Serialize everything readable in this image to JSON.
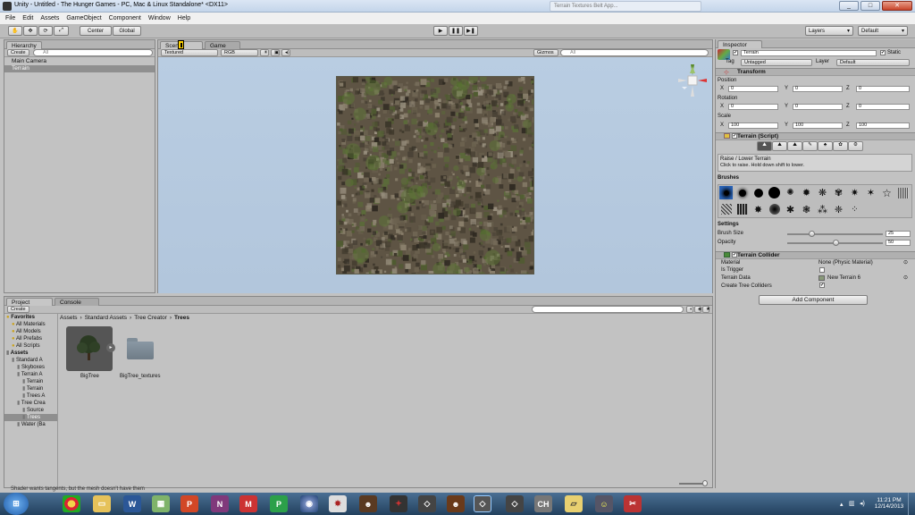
{
  "window": {
    "title": "Unity - Untitled - The Hunger Games - PC, Mac & Linux Standalone* <DX11>",
    "bg_tab_title": "Terrain Textures Belt App...",
    "controls": [
      "_",
      "□",
      "✕"
    ]
  },
  "menu": [
    "File",
    "Edit",
    "Assets",
    "GameObject",
    "Component",
    "Window",
    "Help"
  ],
  "toolbar": {
    "center_label": "Center",
    "global_label": "Global",
    "layers_label": "Layers",
    "layout_label": "Default"
  },
  "hierarchy": {
    "tab": "Hierarchy",
    "create": "Create",
    "search_placeholder": "All",
    "items": [
      "Main Camera",
      "Terrain"
    ]
  },
  "scene": {
    "tab_scene": "Scene",
    "tab_game": "Game",
    "render_mode": "Textured",
    "color_mode": "RGB",
    "gizmos": "Gizmos",
    "search_placeholder": "All"
  },
  "inspector": {
    "tab": "Inspector",
    "object_name": "Terrain",
    "static_label": "Static",
    "tag_label": "Tag",
    "tag_value": "Untagged",
    "layer_label": "Layer",
    "layer_value": "Default",
    "transform": {
      "title": "Transform",
      "position_label": "Position",
      "rotation_label": "Rotation",
      "scale_label": "Scale",
      "position": [
        "0",
        "0",
        "0"
      ],
      "rotation": [
        "0",
        "0",
        "0"
      ],
      "scale": [
        "100",
        "100",
        "100"
      ]
    },
    "terrain_script": {
      "title": "Terrain (Script)",
      "tool_title": "Raise / Lower Terrain",
      "tool_desc": "Click to raise. Hold down shift to lower.",
      "brushes_label": "Brushes",
      "settings_label": "Settings",
      "brush_size_label": "Brush Size",
      "brush_size": "25",
      "brush_size_level": 0.25,
      "opacity_label": "Opacity",
      "opacity": "50",
      "opacity_level": 0.5
    },
    "collider": {
      "title": "Terrain Collider",
      "material_label": "Material",
      "material_value": "None (Physic Material)",
      "trigger_label": "Is Trigger",
      "data_label": "Terrain Data",
      "data_value": "New Terrain 6",
      "trees_label": "Create Tree Colliders"
    },
    "add_component": "Add Component"
  },
  "project": {
    "tab_project": "Project",
    "tab_console": "Console",
    "create": "Create",
    "breadcrumb": [
      "Assets",
      "Standard Assets",
      "Tree Creator",
      "Trees"
    ],
    "tree": [
      {
        "label": "Favorites",
        "indent": 0,
        "bold": true
      },
      {
        "label": "All Materials",
        "indent": 1
      },
      {
        "label": "All Models",
        "indent": 1
      },
      {
        "label": "All Prefabs",
        "indent": 1
      },
      {
        "label": "All Scripts",
        "indent": 1
      },
      {
        "label": "Assets",
        "indent": 0,
        "bold": true
      },
      {
        "label": "Standard A",
        "indent": 1
      },
      {
        "label": "Skyboxes",
        "indent": 2
      },
      {
        "label": "Terrain A",
        "indent": 2
      },
      {
        "label": "Terrain",
        "indent": 3
      },
      {
        "label": "Terrain",
        "indent": 3
      },
      {
        "label": "Trees A",
        "indent": 3
      },
      {
        "label": "Tree Crea",
        "indent": 2
      },
      {
        "label": "Source",
        "indent": 3
      },
      {
        "label": "Trees",
        "indent": 3,
        "selected": true
      },
      {
        "label": "Water (Ba",
        "indent": 2
      }
    ],
    "assets": [
      {
        "label": "BigTree",
        "kind": "prefab"
      },
      {
        "label": "BigTree_textures",
        "kind": "folder"
      }
    ]
  },
  "status": "Shader wants tangents, but the mesh  doesn't have them",
  "taskbar": {
    "time": "11:21 PM",
    "date": "12/14/2013"
  }
}
